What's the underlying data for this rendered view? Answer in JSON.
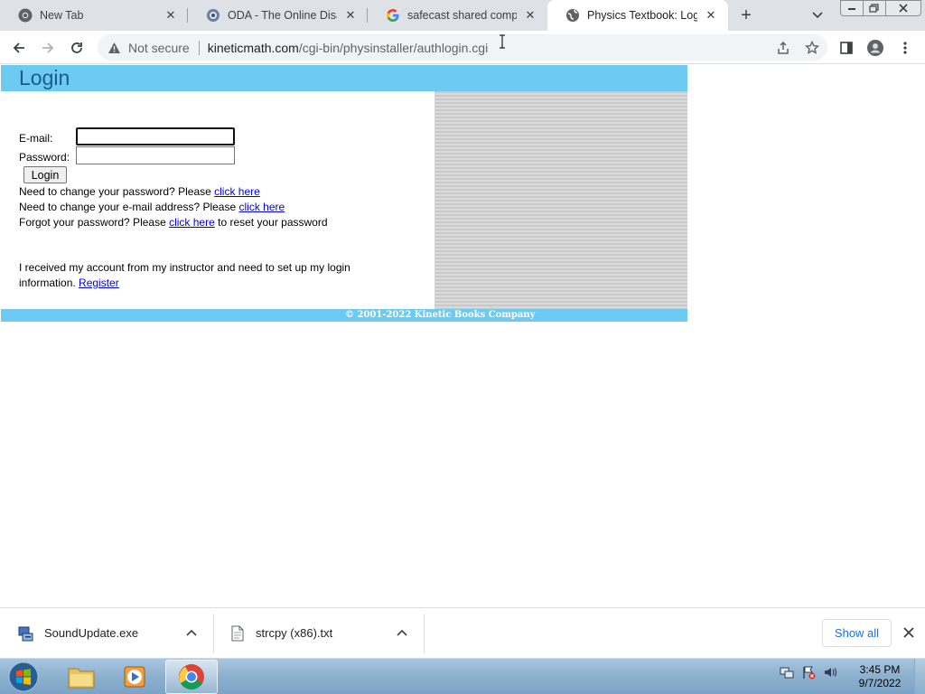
{
  "browser": {
    "tabs": [
      {
        "title": "New Tab",
        "favicon": "chrome-icon",
        "active": false
      },
      {
        "title": "ODA - The Online Disassembler",
        "favicon": "oda-globe-icon",
        "active": false
      },
      {
        "title": "safecast shared components",
        "favicon": "google-g-icon",
        "active": false
      },
      {
        "title": "Physics Textbook: Login",
        "favicon": "globe-icon",
        "active": true
      }
    ],
    "new_tab_label": "+",
    "address": {
      "security_label": "Not secure",
      "host": "kineticmath.com",
      "path": "/cgi-bin/physinstaller/authlogin.cgi"
    }
  },
  "page": {
    "header_title": "Login",
    "form": {
      "email_label": "E-mail:",
      "email_value": "",
      "password_label": "Password:",
      "password_value": "",
      "login_button": "Login"
    },
    "links": {
      "change_password_text": "Need to change your password? Please ",
      "change_password_link": "click here",
      "change_email_text": "Need to change your e-mail address? Please ",
      "change_email_link": "click here",
      "forgot_text": "Forgot your password? Please ",
      "forgot_link": "click here",
      "forgot_suffix": " to reset your password"
    },
    "register": {
      "line1": "I received my account from my instructor and need to set up my login",
      "line2": "information. ",
      "link": "Register"
    },
    "footer": "© 2001-2022 Kinetic Books Company",
    "colors": {
      "accent_bar": "#6dcaf0",
      "title_text": "#1a5b8f",
      "link": "#0000ee"
    }
  },
  "downloads": {
    "items": [
      {
        "name": "SoundUpdate.exe",
        "icon": "installer-icon"
      },
      {
        "name": "strcpy (x86).txt",
        "icon": "text-file-icon"
      }
    ],
    "show_all": "Show all"
  },
  "taskbar": {
    "apps": [
      {
        "name": "Windows Explorer",
        "icon": "folder-icon",
        "active": false
      },
      {
        "name": "Windows Media Player",
        "icon": "media-player-icon",
        "active": false
      },
      {
        "name": "Google Chrome",
        "icon": "chrome-icon",
        "active": true
      }
    ],
    "clock": {
      "time": "3:45 PM",
      "date": "9/7/2022"
    }
  }
}
